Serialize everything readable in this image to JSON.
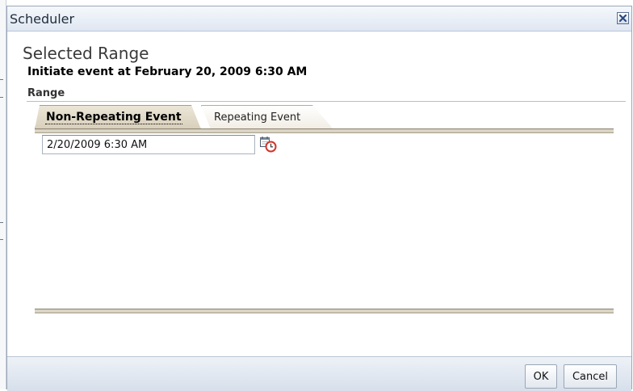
{
  "dialog": {
    "title": "Scheduler",
    "close_icon": "close-icon"
  },
  "content": {
    "heading": "Selected Range",
    "subheading": "Initiate event at February 20, 2009 6:30 AM",
    "range_label": "Range"
  },
  "tabs": [
    {
      "label": "Non-Repeating Event",
      "active": true
    },
    {
      "label": "Repeating Event",
      "active": false
    }
  ],
  "date_field": {
    "value": "2/20/2009 6:30 AM",
    "icon": "calendar-clock-icon"
  },
  "buttons": {
    "ok": "OK",
    "cancel": "Cancel"
  },
  "colors": {
    "titlebar": "#dfe7f1",
    "tab_active": "#d8cfba",
    "footer": "#d6dfeb",
    "close_x": "#2b4a7e",
    "clock_accent": "#d2342a"
  }
}
